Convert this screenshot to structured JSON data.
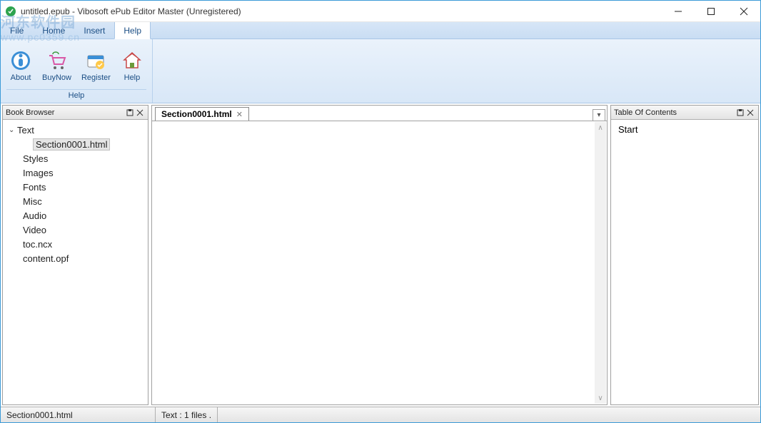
{
  "window": {
    "title": "untitled.epub - Vibosoft ePub Editor Master (Unregistered)"
  },
  "menus": {
    "file": "File",
    "home": "Home",
    "insert": "Insert",
    "help": "Help"
  },
  "ribbon": {
    "about": "About",
    "buynow": "BuyNow",
    "register": "Register",
    "help": "Help",
    "group_label": "Help"
  },
  "panels": {
    "book_browser": "Book Browser",
    "toc": "Table Of Contents"
  },
  "browser_tree": {
    "text": "Text",
    "section": "Section0001.html",
    "styles": "Styles",
    "images": "Images",
    "fonts": "Fonts",
    "misc": "Misc",
    "audio": "Audio",
    "video": "Video",
    "tocncx": "toc.ncx",
    "contentopf": "content.opf"
  },
  "tabs": {
    "active": "Section0001.html"
  },
  "toc_items": {
    "start": "Start"
  },
  "status": {
    "left": "Section0001.html",
    "right": "Text : 1 files ."
  },
  "watermark": {
    "line1": "河东软件园",
    "line2": "www.pc0359.cn"
  }
}
